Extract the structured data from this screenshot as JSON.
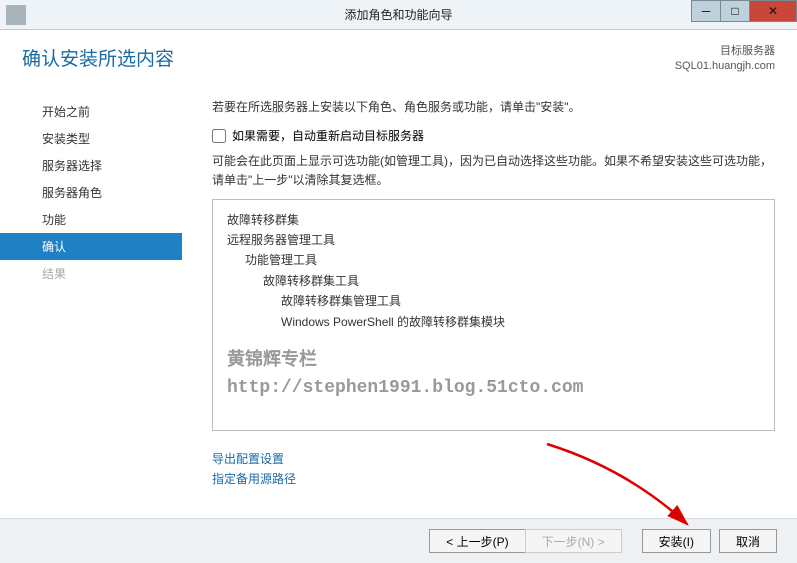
{
  "window": {
    "title": "添加角色和功能向导"
  },
  "header": {
    "page_title": "确认安装所选内容",
    "server_label": "目标服务器",
    "server_name": "SQL01.huangjh.com"
  },
  "sidebar": {
    "items": [
      {
        "label": "开始之前"
      },
      {
        "label": "安装类型"
      },
      {
        "label": "服务器选择"
      },
      {
        "label": "服务器角色"
      },
      {
        "label": "功能"
      },
      {
        "label": "确认"
      },
      {
        "label": "结果"
      }
    ]
  },
  "main": {
    "intro": "若要在所选服务器上安装以下角色、角色服务或功能，请单击\"安装\"。",
    "checkbox_label": "如果需要，自动重新启动目标服务器",
    "note": "可能会在此页面上显示可选功能(如管理工具)，因为已自动选择这些功能。如果不希望安装这些可选功能，请单击\"上一步\"以清除其复选框。",
    "tree": {
      "l0": "故障转移群集",
      "l1": "远程服务器管理工具",
      "l2": "功能管理工具",
      "l3": "故障转移群集工具",
      "l4a": "故障转移群集管理工具",
      "l4b": "Windows PowerShell 的故障转移群集模块"
    },
    "watermark_line1": "黄锦辉专栏",
    "watermark_line2": "http://stephen1991.blog.51cto.com",
    "links": {
      "export": "导出配置设置",
      "alt_source": "指定备用源路径"
    }
  },
  "footer": {
    "prev": "< 上一步(P)",
    "next": "下一步(N) >",
    "install": "安装(I)",
    "cancel": "取消"
  }
}
